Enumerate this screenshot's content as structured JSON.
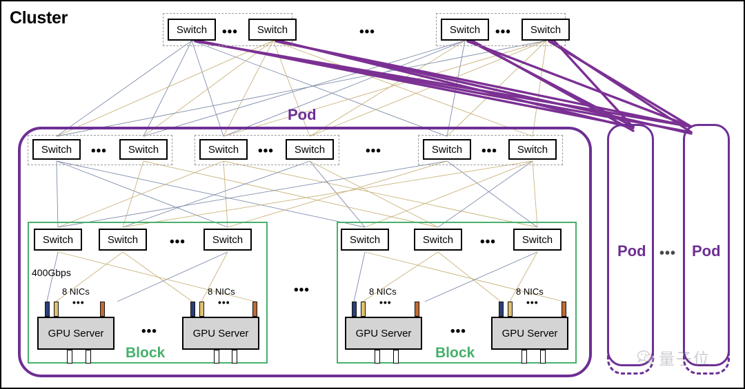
{
  "diagram": {
    "title": "Cluster",
    "labels": {
      "cluster": "Cluster",
      "pod": "Pod",
      "block": "Block",
      "switch": "Switch",
      "gpu_server": "GPU Server",
      "bandwidth": "400Gbps",
      "nics": "8 NICs",
      "ellipsis": "•••"
    },
    "colors": {
      "pod_purple": "#6d2f94",
      "block_green": "#46b06b",
      "switch_border": "#000000",
      "gpu_fill": "#d4d4d4",
      "dashed_group": "#9a9a9a",
      "link_blue": "#7d8cab",
      "link_tan": "#c9b37a",
      "nic_blue": "#2b3f77",
      "nic_gold": "#e0c070",
      "nic_orange": "#c06a35"
    },
    "tiers": {
      "core": {
        "name": "core-switch-tier",
        "groups": [
          {
            "switches": [
              "Switch",
              "Switch"
            ],
            "inner_ellipsis": "•••"
          },
          {
            "switches": [
              "Switch",
              "Switch"
            ],
            "inner_ellipsis": "•••"
          }
        ],
        "between_groups_ellipsis": "•••"
      },
      "pod": {
        "name": "pod-switch-tier",
        "groups": [
          {
            "switches": [
              "Switch",
              "Switch"
            ],
            "inner_ellipsis": "•••"
          },
          {
            "switches": [
              "Switch",
              "Switch"
            ],
            "inner_ellipsis": "•••"
          },
          {
            "switches": [
              "Switch",
              "Switch"
            ],
            "inner_ellipsis": "•••"
          }
        ],
        "between_groups_ellipsis": "•••"
      },
      "block": {
        "name": "block-switch-tier",
        "blocks": [
          {
            "label": "Block",
            "switches": [
              "Switch",
              "Switch",
              "Switch"
            ],
            "switch_ellipsis": "•••",
            "bandwidth_label": "400Gbps",
            "servers": [
              {
                "label": "GPU Server",
                "nics_label": "8 NICs",
                "nics_ellipsis": "•••"
              },
              {
                "label": "GPU Server",
                "nics_label": "8 NICs",
                "nics_ellipsis": "•••"
              }
            ],
            "server_ellipsis": "•••"
          },
          {
            "label": "Block",
            "switches": [
              "Switch",
              "Switch",
              "Switch"
            ],
            "switch_ellipsis": "•••",
            "bandwidth_label": "",
            "servers": [
              {
                "label": "GPU Server",
                "nics_label": "8 NICs",
                "nics_ellipsis": "•••"
              },
              {
                "label": "GPU Server",
                "nics_label": "8 NICs",
                "nics_ellipsis": "•••"
              }
            ],
            "server_ellipsis": "•••"
          }
        ],
        "between_blocks_ellipsis": "•••"
      }
    },
    "collapsed_pods": {
      "name": "collapsed-pod-column",
      "items": [
        {
          "label": "Pod"
        },
        {
          "label": "Pod"
        }
      ],
      "between_ellipsis": "•••"
    },
    "watermark": {
      "text": "量子位"
    }
  }
}
